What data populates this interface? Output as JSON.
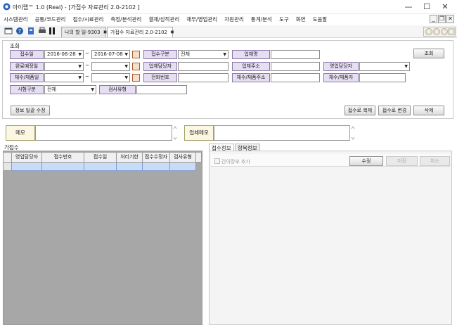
{
  "window": {
    "title": "아이랩™ 1.0 (Real) - [가접수 자료관리 2.0-2102 ]",
    "min": "—",
    "max": "☐",
    "close": "✕"
  },
  "menu": [
    "시스템관리",
    "공통/코드관리",
    "접수/시료관리",
    "측정/분석관리",
    "결재/성적관리",
    "재무/영업관리",
    "자원관리",
    "통계/분석",
    "도구",
    "화면",
    "도움말"
  ],
  "mdi": {
    "min": "_",
    "restore": "❐",
    "close": "✕"
  },
  "tabs": [
    {
      "label": "나의 할 일-9303",
      "close": "✖"
    },
    {
      "label": "가접수 자료관리 2.0-2102",
      "close": "✖"
    }
  ],
  "search": {
    "group_title": "조회",
    "receipt_date_label": "접수일",
    "date_from": "2016-06-28",
    "date_to": "2016-07-08",
    "tilde": "~",
    "due_date_label": "완료예정일",
    "sample_date_label": "채수/채품일",
    "test_type_label": "시험구분",
    "test_type_value": "전체",
    "receipt_type_label": "접수구분",
    "receipt_type_value": "전체",
    "company_label": "업체명",
    "company_manager_label": "업체담당자",
    "phone_label": "전화번호",
    "inspection_type_label": "검사유형",
    "company_address_label": "업체주소",
    "sample_address_label": "채수/채품주소",
    "sales_manager_label": "영업담당자",
    "sampler_label": "채수/채품자",
    "query_button": "조회"
  },
  "actions": {
    "bulk_edit": "정보 일괄 수정",
    "copy_receipt": "접수로 복제",
    "change_receipt": "접수로 변경",
    "delete": "삭제"
  },
  "memo": {
    "memo_label": "메모",
    "company_memo_label": "업체메모"
  },
  "grid": {
    "title": "가접수",
    "columns": [
      "영업담당자",
      "접수번호",
      "접수일",
      "처리기한",
      "접수수정자",
      "검사유형"
    ]
  },
  "detail": {
    "tabs": [
      "접수정보",
      "항목정보"
    ],
    "checkbox_label": "간이장부 추가",
    "edit": "수정",
    "save": "저장",
    "cancel": "취소"
  }
}
